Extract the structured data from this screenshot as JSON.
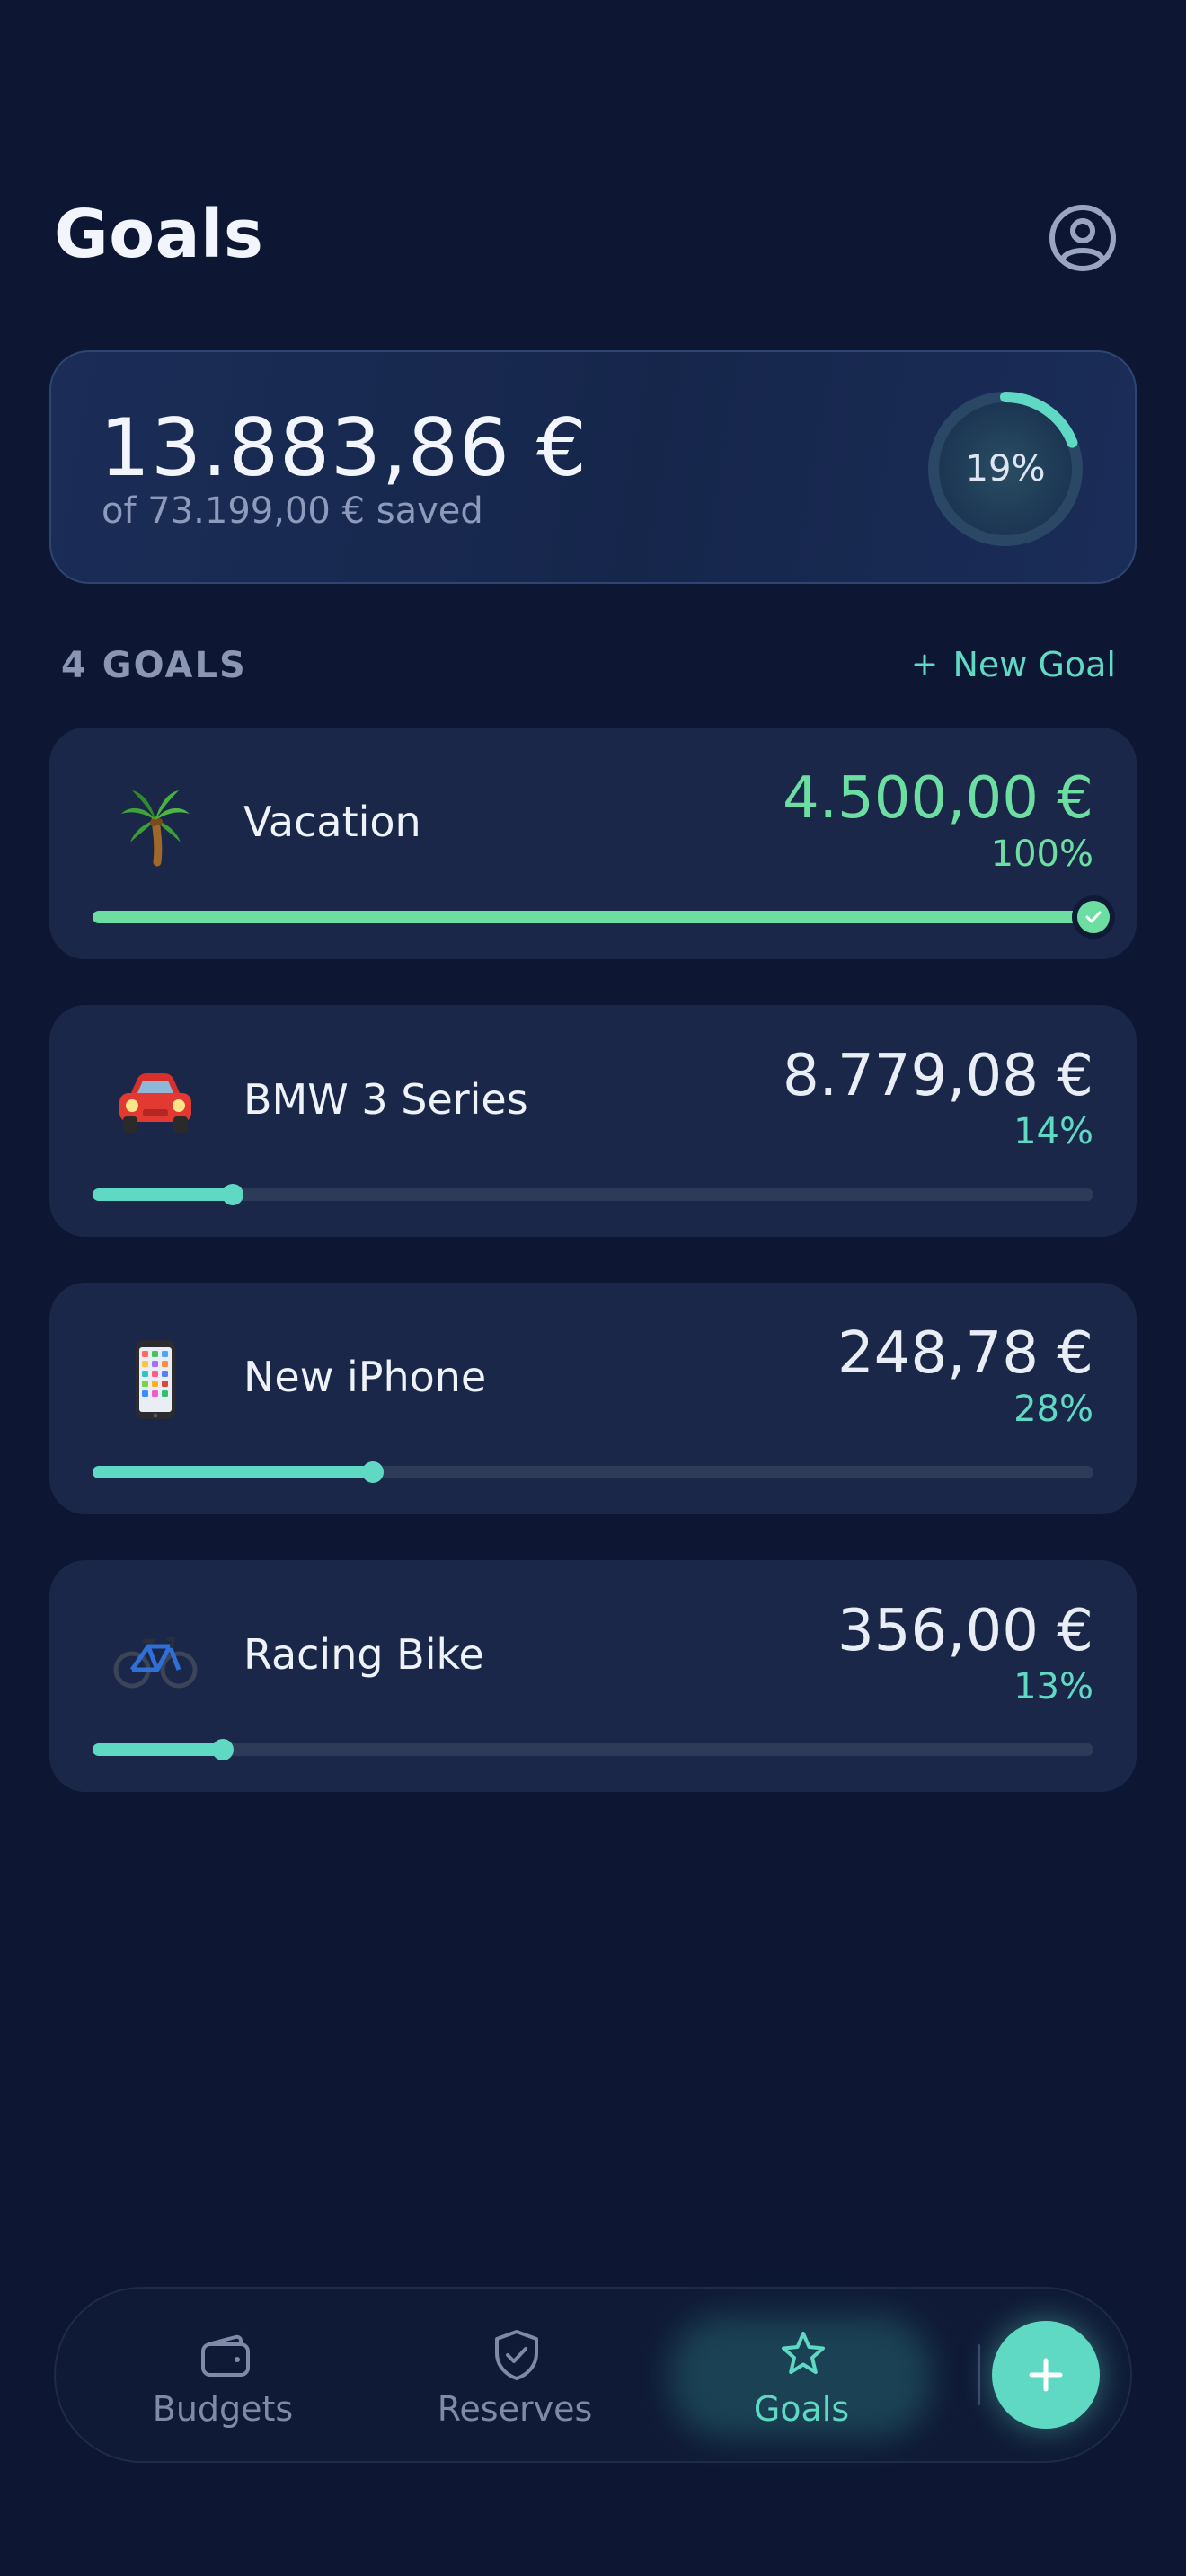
{
  "header": {
    "title": "Goals",
    "profile_icon": "user-circle-icon"
  },
  "summary": {
    "saved_amount": "13.883,86 €",
    "target_text": "of 73.199,00 € saved",
    "progress_label": "19%",
    "progress_fraction": 0.19
  },
  "goals_section": {
    "count_label": "4 GOALS",
    "new_goal_label": "New Goal",
    "new_goal_icon": "plus-icon"
  },
  "goals": [
    {
      "emoji": "🌴",
      "icon": "palm-tree-icon",
      "name": "Vacation",
      "amount": "4.500,00 €",
      "percent_label": "100%",
      "progress": 1.0,
      "complete": true
    },
    {
      "emoji": "🚘",
      "icon": "car-icon",
      "name": "BMW 3 Series",
      "amount": "8.779,08 €",
      "percent_label": "14%",
      "progress": 0.14,
      "complete": false
    },
    {
      "emoji": "📱",
      "icon": "phone-icon",
      "name": "New iPhone",
      "amount": "248,78 €",
      "percent_label": "28%",
      "progress": 0.28,
      "complete": false
    },
    {
      "emoji": "🚲",
      "icon": "bicycle-icon",
      "name": "Racing Bike",
      "amount": "356,00 €",
      "percent_label": "13%",
      "progress": 0.13,
      "complete": false
    }
  ],
  "nav": {
    "items": [
      {
        "label": "Budgets",
        "icon": "wallet-icon",
        "active": false
      },
      {
        "label": "Reserves",
        "icon": "shield-check-icon",
        "active": false
      },
      {
        "label": "Goals",
        "icon": "star-icon",
        "active": true
      }
    ],
    "add_icon": "plus-icon"
  },
  "colors": {
    "background": "#0d1733",
    "accent": "#5fd9c4",
    "complete": "#6ddea2",
    "card": "#1a2748"
  }
}
